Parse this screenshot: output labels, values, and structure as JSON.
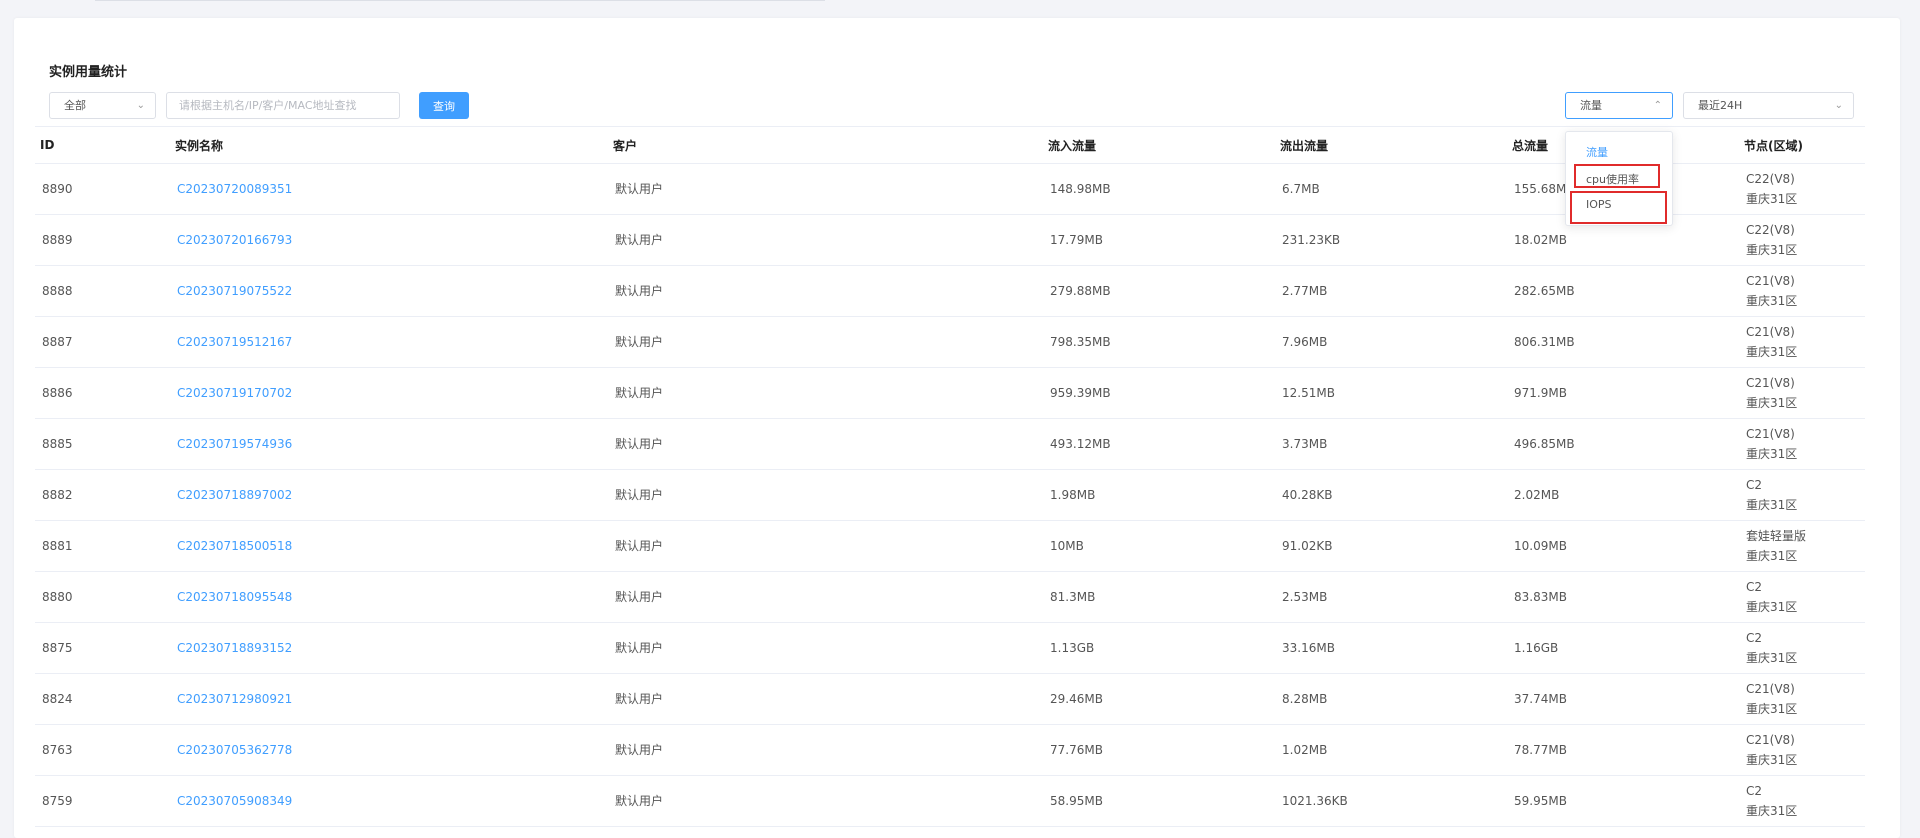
{
  "page": {
    "title": "实例用量统计"
  },
  "filters": {
    "scope_select": "全部",
    "search_placeholder": "请根据主机名/IP/客户/MAC地址查找",
    "query_button": "查询",
    "metric_select": "流量",
    "range_select": "最近24H"
  },
  "dropdown": {
    "options": [
      "流量",
      "cpu使用率",
      "IOPS"
    ],
    "selected": "流量"
  },
  "table": {
    "headers": [
      "ID",
      "实例名称",
      "客户",
      "流入流量",
      "流出流量",
      "总流量",
      "节点(区域)"
    ],
    "rows": [
      {
        "id": "8890",
        "name": "C20230720089351",
        "customer": "默认用户",
        "in": "148.98MB",
        "out": "6.7MB",
        "total": "155.68MB",
        "node": "C22(V8)",
        "region": "重庆31区"
      },
      {
        "id": "8889",
        "name": "C20230720166793",
        "customer": "默认用户",
        "in": "17.79MB",
        "out": "231.23KB",
        "total": "18.02MB",
        "node": "C22(V8)",
        "region": "重庆31区"
      },
      {
        "id": "8888",
        "name": "C20230719075522",
        "customer": "默认用户",
        "in": "279.88MB",
        "out": "2.77MB",
        "total": "282.65MB",
        "node": "C21(V8)",
        "region": "重庆31区"
      },
      {
        "id": "8887",
        "name": "C20230719512167",
        "customer": "默认用户",
        "in": "798.35MB",
        "out": "7.96MB",
        "total": "806.31MB",
        "node": "C21(V8)",
        "region": "重庆31区"
      },
      {
        "id": "8886",
        "name": "C20230719170702",
        "customer": "默认用户",
        "in": "959.39MB",
        "out": "12.51MB",
        "total": "971.9MB",
        "node": "C21(V8)",
        "region": "重庆31区"
      },
      {
        "id": "8885",
        "name": "C20230719574936",
        "customer": "默认用户",
        "in": "493.12MB",
        "out": "3.73MB",
        "total": "496.85MB",
        "node": "C21(V8)",
        "region": "重庆31区"
      },
      {
        "id": "8882",
        "name": "C20230718897002",
        "customer": "默认用户",
        "in": "1.98MB",
        "out": "40.28KB",
        "total": "2.02MB",
        "node": "C2",
        "region": "重庆31区"
      },
      {
        "id": "8881",
        "name": "C20230718500518",
        "customer": "默认用户",
        "in": "10MB",
        "out": "91.02KB",
        "total": "10.09MB",
        "node": "套娃轻量版",
        "region": "重庆31区"
      },
      {
        "id": "8880",
        "name": "C20230718095548",
        "customer": "默认用户",
        "in": "81.3MB",
        "out": "2.53MB",
        "total": "83.83MB",
        "node": "C2",
        "region": "重庆31区"
      },
      {
        "id": "8875",
        "name": "C20230718893152",
        "customer": "默认用户",
        "in": "1.13GB",
        "out": "33.16MB",
        "total": "1.16GB",
        "node": "C2",
        "region": "重庆31区"
      },
      {
        "id": "8824",
        "name": "C20230712980921",
        "customer": "默认用户",
        "in": "29.46MB",
        "out": "8.28MB",
        "total": "37.74MB",
        "node": "C21(V8)",
        "region": "重庆31区"
      },
      {
        "id": "8763",
        "name": "C20230705362778",
        "customer": "默认用户",
        "in": "77.76MB",
        "out": "1.02MB",
        "total": "78.77MB",
        "node": "C21(V8)",
        "region": "重庆31区"
      },
      {
        "id": "8759",
        "name": "C20230705908349",
        "customer": "默认用户",
        "in": "58.95MB",
        "out": "1021.36KB",
        "total": "59.95MB",
        "node": "C2",
        "region": "重庆31区"
      }
    ]
  },
  "colors": {
    "primary": "#409eff",
    "highlight": "#e02b2b"
  }
}
